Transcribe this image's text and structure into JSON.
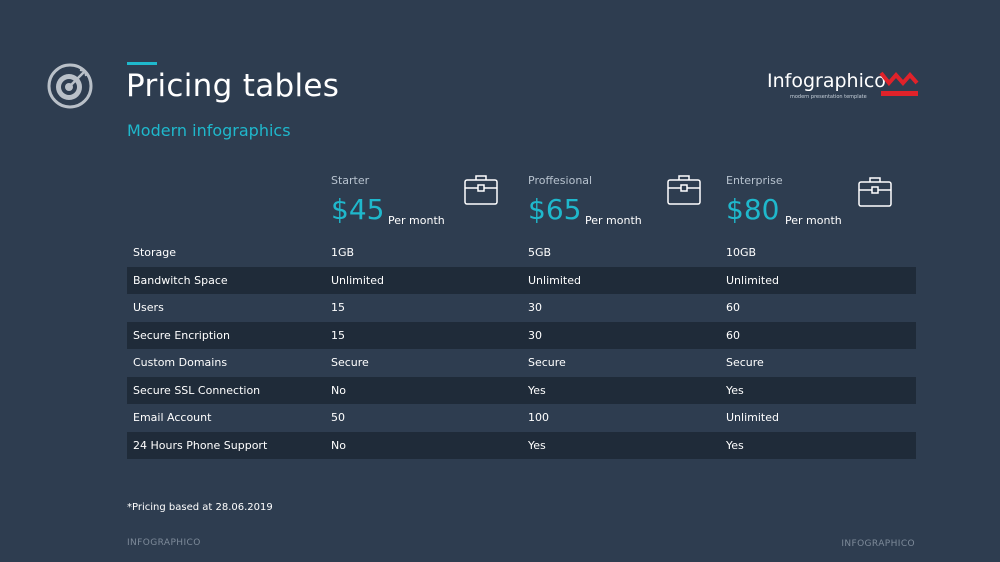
{
  "header": {
    "title": "Pricing tables",
    "subtitle": "Modern infographics",
    "icon": "target-icon"
  },
  "brand": {
    "name": "Infographico",
    "tagline": "modern presentation template",
    "logo_color": "#e0222a"
  },
  "plans": [
    {
      "name": "Starter",
      "price": "$45",
      "period": "Per month",
      "icon": "briefcase-icon"
    },
    {
      "name": "Proffesional",
      "price": "$65",
      "period": "Per month",
      "icon": "briefcase-icon"
    },
    {
      "name": "Enterprise",
      "price": "$80",
      "period": "Per month",
      "icon": "briefcase-icon"
    }
  ],
  "table": {
    "rows": [
      {
        "feature": "Storage",
        "values": [
          "1GB",
          "5GB",
          "10GB"
        ]
      },
      {
        "feature": "Bandwitch Space",
        "values": [
          "Unlimited",
          "Unlimited",
          "Unlimited"
        ]
      },
      {
        "feature": "Users",
        "values": [
          "15",
          "30",
          "60"
        ]
      },
      {
        "feature": "Secure Encription",
        "values": [
          "15",
          "30",
          "60"
        ]
      },
      {
        "feature": "Custom Domains",
        "values": [
          "Secure",
          "Secure",
          "Secure"
        ]
      },
      {
        "feature": "Secure SSL Connection",
        "values": [
          "No",
          "Yes",
          "Yes"
        ]
      },
      {
        "feature": "Email Account",
        "values": [
          "50",
          "100",
          "Unlimited"
        ]
      },
      {
        "feature": "24 Hours Phone Support",
        "values": [
          "No",
          "Yes",
          "Yes"
        ]
      }
    ]
  },
  "note": "*Pricing based at 28.06.2019",
  "footer": {
    "left": "INFOGRAPHICO",
    "right": "INFOGRAPHICO"
  },
  "colors": {
    "background": "#2e3d50",
    "accent": "#1fb8cc",
    "row_alt": "#1f2b39"
  }
}
